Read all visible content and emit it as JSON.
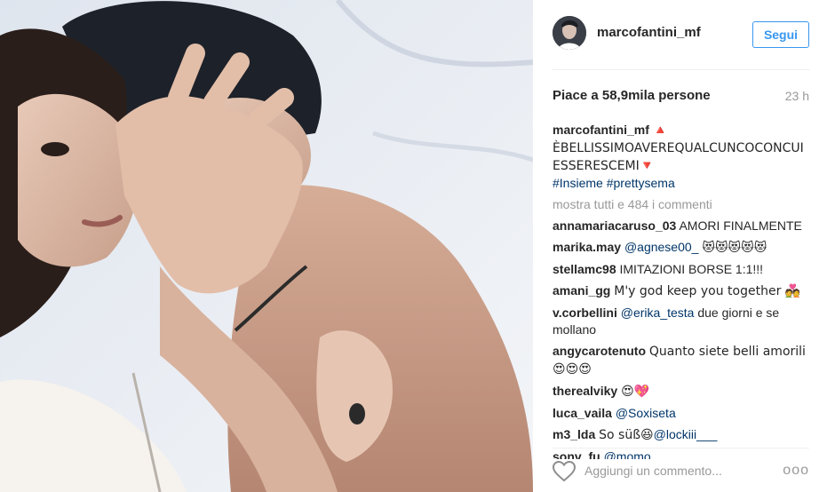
{
  "post": {
    "username": "marcofantini_mf",
    "follow_label": "Segui",
    "likes_text": "Piace a 58,9mila persone",
    "time_ago": "23 h"
  },
  "caption": {
    "username": "marcofantini_mf",
    "text_before": "🔺 ÈBELLISSIMOAVEREQUALCUNCOCONCUIESSERESCEMI",
    "text_after": "🔻",
    "tag1": "#Insieme",
    "tag2": "#prettysema"
  },
  "more_comments": "mostra tutti e 484 i commenti",
  "comments": [
    {
      "user": "annamariacaruso_03",
      "text": "AMORI FINALMENTE"
    },
    {
      "user": "marika.may",
      "mention": "@agnese00_",
      "text": "😻😻😻😻😻"
    },
    {
      "user": "stellamc98",
      "text": "IMITAZIONI BORSE 1:1!!!"
    },
    {
      "user": "amani_gg",
      "text": "M'y god keep you together 💑"
    },
    {
      "user": "v.corbellini",
      "mention": "@erika_testa",
      "text": "due giorni e se mollano"
    },
    {
      "user": "angycarotenuto",
      "text": "Quanto siete belli amorili 😍😍😍"
    },
    {
      "user": "therealviky",
      "text": "😍💖"
    },
    {
      "user": "luca_vaila",
      "mention": "@Soxiseta",
      "text": ""
    },
    {
      "user": "m3_lda",
      "text": "So süß😆",
      "mention_after": "@lockiii___"
    },
    {
      "user": "sonv_fu",
      "mention": "@momo",
      "text": ""
    }
  ],
  "footer": {
    "add_comment_placeholder": "Aggiungi un commento...",
    "more_icon_glyph": "ooo"
  },
  "colors": {
    "accent": "#3897f0",
    "link": "#003569",
    "muted": "#999999"
  }
}
